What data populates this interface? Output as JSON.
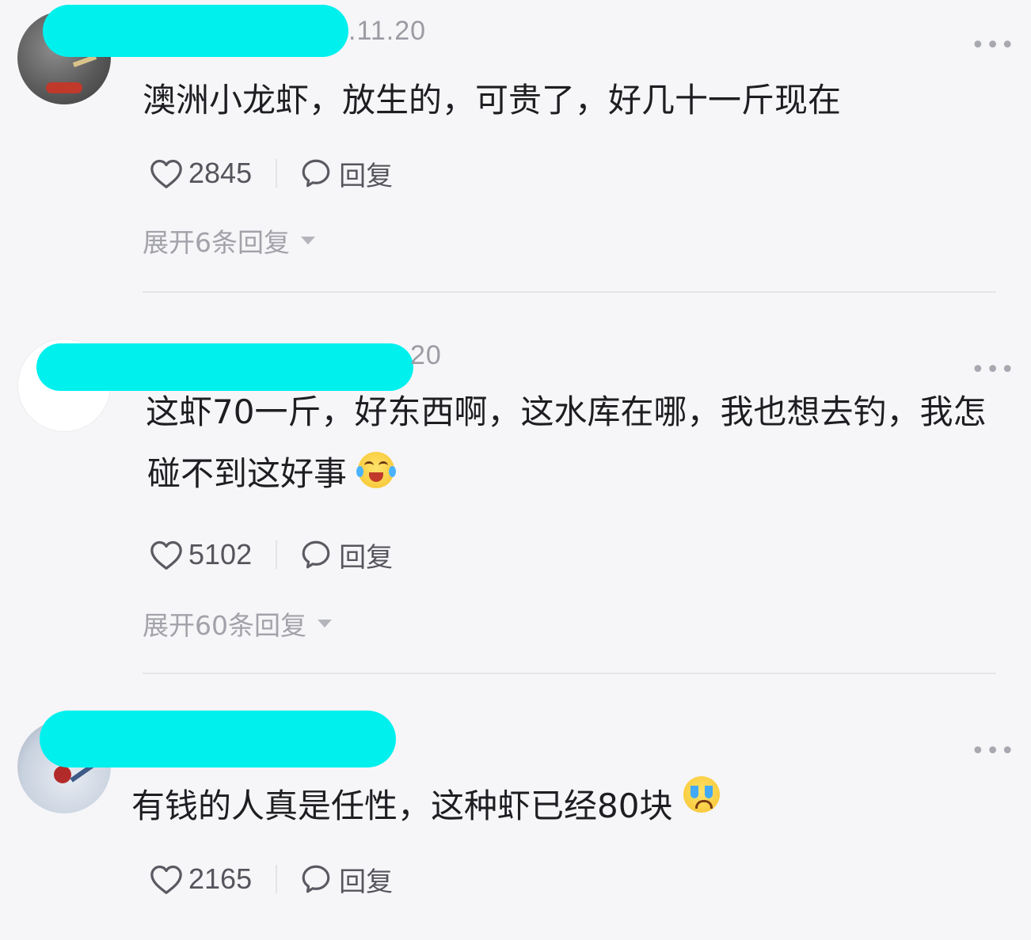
{
  "comments": [
    {
      "date_fragment": ".11.20",
      "text": "澳洲小龙虾，放生的，可贵了，好几十一斤现在",
      "likes": "2845",
      "reply_label": "回复",
      "expand_label": "展开6条回复"
    },
    {
      "date_fragment": "20",
      "text_line1": "这虾70一斤，好东西啊，这水库在哪，我也想去钓，我怎",
      "text_line2": "碰不到这好事",
      "likes": "5102",
      "reply_label": "回复",
      "expand_label": "展开60条回复"
    },
    {
      "text": "有钱的人真是任性，这种虾已经80块",
      "likes": "2165",
      "reply_label": "回复"
    }
  ],
  "icons": {
    "like": "heart-outline-icon",
    "reply": "speech-bubble-icon",
    "more": "more-dots-icon",
    "expand": "caret-down-icon",
    "emoji_1": "laughing-tears-emoji",
    "emoji_2": "crying-emoji"
  },
  "colors": {
    "redaction": "#00f0ee",
    "background": "#f6f6f8"
  }
}
